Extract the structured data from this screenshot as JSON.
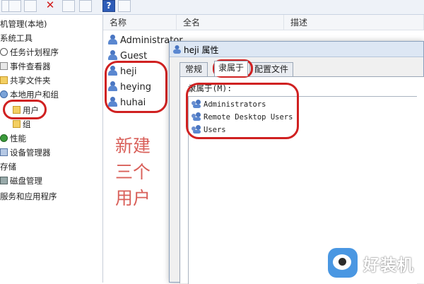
{
  "toolbar": {
    "buttons": [
      {
        "icon": "properties-icon"
      },
      {
        "icon": "help-list-icon"
      },
      {
        "icon": "delete-icon",
        "glyph": "✕"
      },
      {
        "icon": "document-icon"
      },
      {
        "icon": "export-icon"
      },
      {
        "icon": "help-icon",
        "glyph": "?"
      },
      {
        "icon": "view-icon"
      }
    ]
  },
  "tree": {
    "items": [
      {
        "label": "机管理(本地)"
      },
      {
        "label": "系统工具"
      },
      {
        "label": "任务计划程序"
      },
      {
        "label": "事件查看器"
      },
      {
        "label": "共享文件夹"
      },
      {
        "label": "本地用户和组"
      },
      {
        "label": "用户"
      },
      {
        "label": "组"
      },
      {
        "label": "性能"
      },
      {
        "label": "设备管理器"
      },
      {
        "label": "存储"
      },
      {
        "label": "磁盘管理"
      },
      {
        "label": "服务和应用程序"
      }
    ]
  },
  "list": {
    "headers": {
      "name": "名称",
      "fullname": "全名",
      "desc": "描述"
    },
    "users": [
      "Administrator",
      "Guest",
      "heji",
      "heying",
      "huhai"
    ]
  },
  "annotation": {
    "line1": "新建",
    "line2": "三个",
    "line3": "用户"
  },
  "dialog": {
    "title": "heji 属性",
    "tabs": [
      "常规",
      "隶属于",
      "配置文件"
    ],
    "active_tab": "隶属于",
    "member_label": "隶属于(M):",
    "groups": [
      "Administrators",
      "Remote Desktop Users",
      "Users"
    ]
  },
  "watermark": {
    "text": "好装机"
  },
  "colors": {
    "highlight_ring": "#d02121",
    "annotation_text": "#d9605a",
    "user_icon": "#4a76c2"
  }
}
